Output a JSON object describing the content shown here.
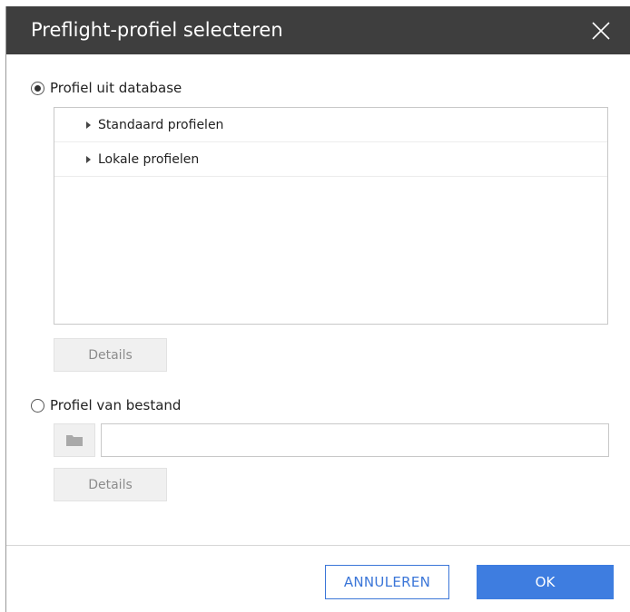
{
  "dialog": {
    "title": "Preflight-profiel selecteren",
    "close_icon": "close-icon"
  },
  "option_database": {
    "label": "Profiel uit database",
    "selected": true,
    "tree_items": [
      {
        "label": "Standaard profielen",
        "icon": "expand-arrow-icon"
      },
      {
        "label": "Lokale profielen",
        "icon": "expand-arrow-icon"
      }
    ],
    "details_label": "Details"
  },
  "option_file": {
    "label": "Profiel van bestand",
    "selected": false,
    "folder_icon": "folder-icon",
    "file_value": "",
    "details_label": "Details"
  },
  "footer": {
    "cancel_label": "ANNULEREN",
    "ok_label": "OK"
  },
  "colors": {
    "titlebar": "#3e3e3e",
    "primary": "#3e7de0",
    "disabled_bg": "#f0f0f0"
  }
}
